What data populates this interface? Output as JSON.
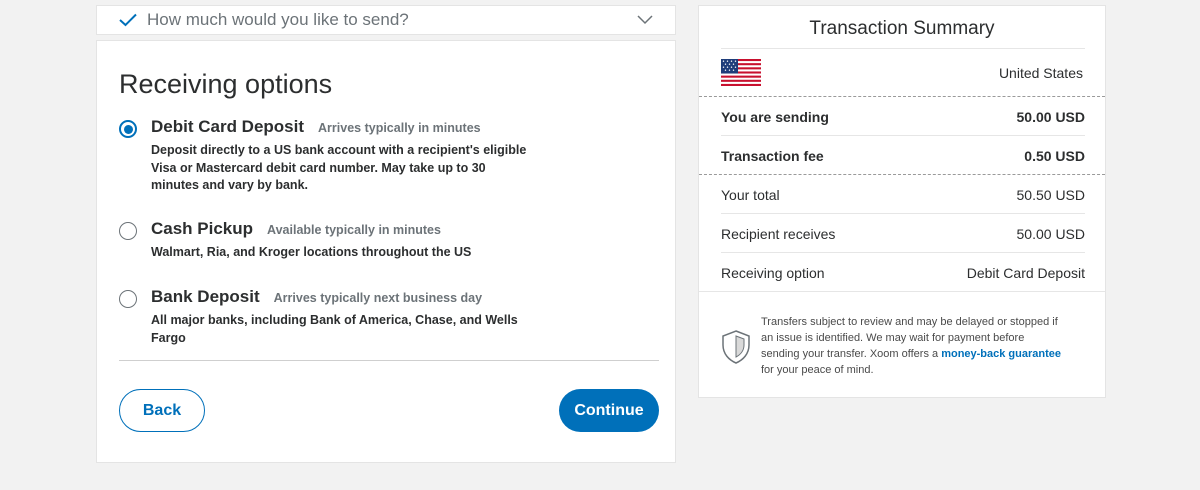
{
  "step": {
    "title": "How much would you like to send?"
  },
  "receiving": {
    "heading": "Receiving options",
    "options": [
      {
        "name": "Debit Card Deposit",
        "time": "Arrives typically in minutes",
        "desc": "Deposit directly to a US bank account with a recipient's eligible Visa or Mastercard debit card number. May take up to 30 minutes and vary by bank.",
        "selected": true
      },
      {
        "name": "Cash Pickup",
        "time": "Available typically in minutes",
        "desc": "Walmart, Ria, and Kroger locations throughout the US",
        "selected": false
      },
      {
        "name": "Bank Deposit",
        "time": "Arrives typically next business day",
        "desc": "All major banks, including Bank of America, Chase, and Wells Fargo",
        "selected": false
      }
    ],
    "back_label": "Back",
    "continue_label": "Continue"
  },
  "summary": {
    "title": "Transaction Summary",
    "country": "United States",
    "rows": [
      {
        "label": "You are sending",
        "value": "50.00 USD"
      },
      {
        "label": "Transaction fee",
        "value": "0.50 USD"
      },
      {
        "label": "Your total",
        "value": "50.50 USD"
      },
      {
        "label": "Recipient receives",
        "value": "50.00 USD"
      },
      {
        "label": "Receiving option",
        "value": "Debit Card Deposit"
      }
    ],
    "notice_text": "Transfers subject to review and may be delayed or stopped if an issue is identified. We may wait for payment before sending your transfer. Xoom offers a ",
    "notice_link": "money-back guarantee",
    "notice_tail": " for your peace of mind."
  },
  "colors": {
    "accent": "#0070ba",
    "check": "#0070ba"
  },
  "icons": {
    "check": "checkmark-icon",
    "chevron": "chevron-down-icon",
    "flag": "us-flag-icon",
    "shield": "shield-icon"
  }
}
